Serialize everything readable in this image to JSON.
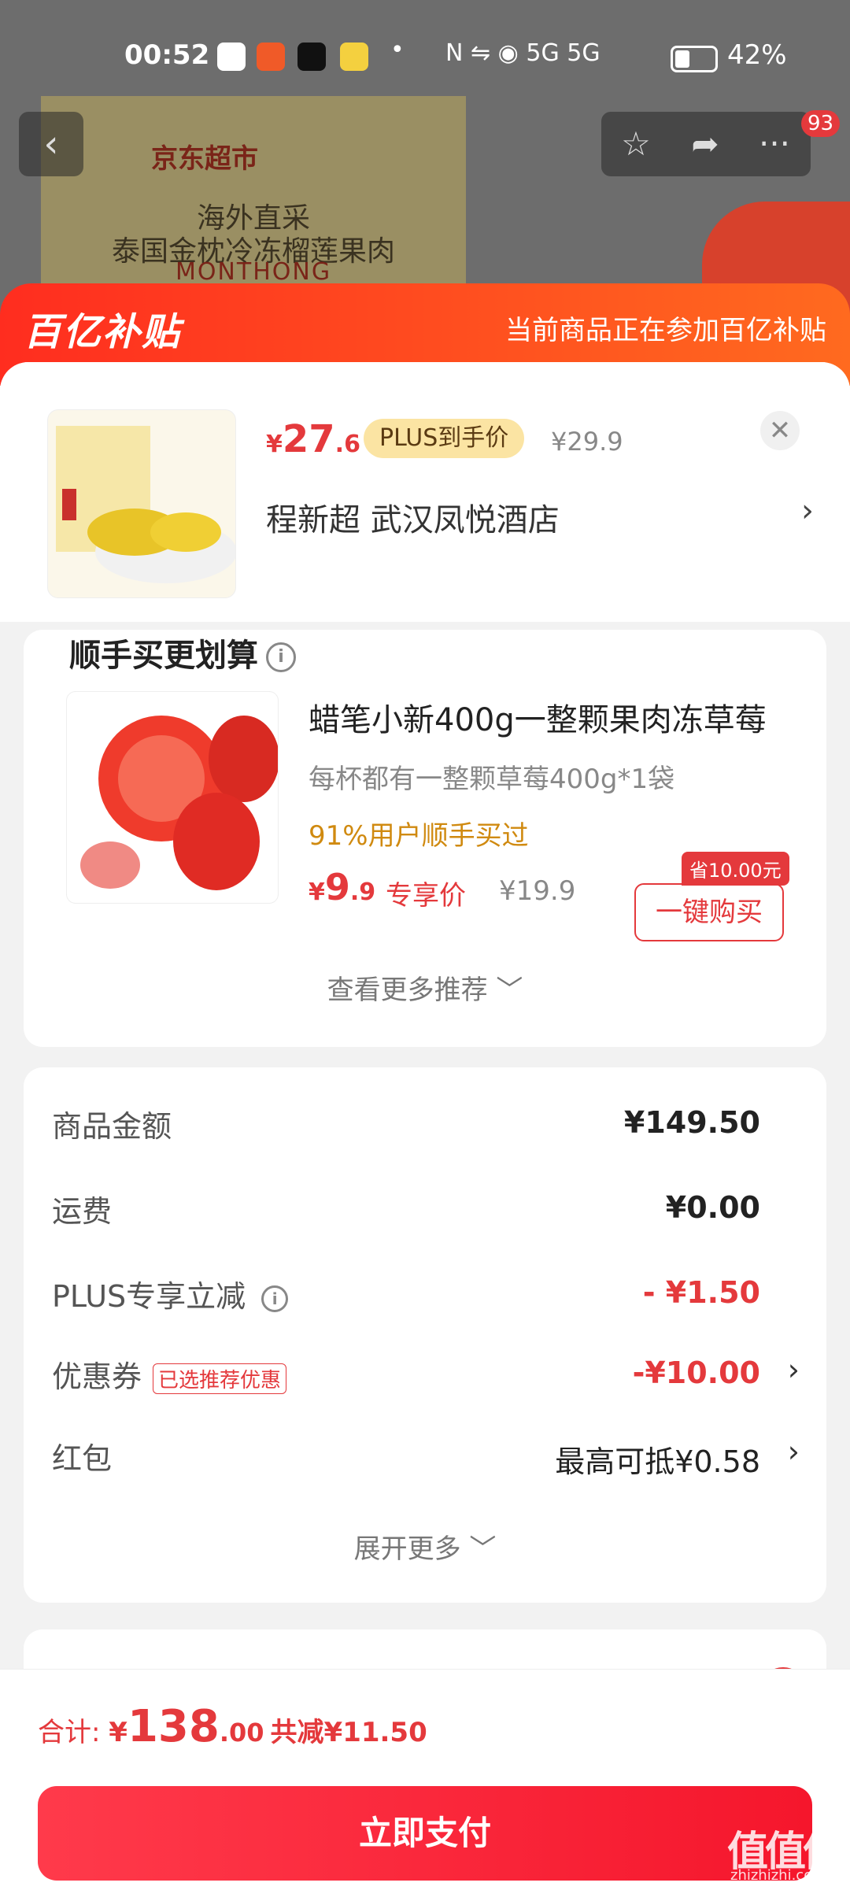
{
  "status": {
    "time": "00:52",
    "app_icons": [
      "baidu-icon",
      "manhua-icon",
      "tiktok-icon",
      "realme-icon"
    ],
    "right": "N ⇋ ◉ 5G 5G",
    "battery": "42%"
  },
  "background": {
    "store_logo": "京东超市",
    "line1": "海外直采",
    "line2": "泰国金枕冷冻榴莲果肉",
    "line3": "MONTHONG",
    "cart_badge": "93"
  },
  "banner": {
    "logo": "百亿补贴",
    "text": "当前商品正在参加百亿补贴"
  },
  "product": {
    "price_currency": "¥",
    "price_int": "27",
    "price_dec": ".6",
    "plus_tag": "PLUS到手价",
    "orig_price": "¥29.9",
    "address": "程新超  武汉凤悦酒店"
  },
  "combo": {
    "title": "顺手买更划算",
    "name": "蜡笔小新400g一整颗果肉冻草莓",
    "desc": "每杯都有一整颗草莓400g*1袋",
    "stat": "91%用户顺手买过",
    "price_currency": "¥",
    "price_int": "9",
    "price_dec": ".9",
    "tag": "专享价",
    "orig_price": "¥19.9",
    "save_badge": "省10.00元",
    "buy_label": "一键购买",
    "more_label": "查看更多推荐 ﹀"
  },
  "totals": {
    "rows": [
      {
        "label": "商品金额",
        "value": "¥149.50"
      },
      {
        "label": "运费",
        "value": "¥0.00"
      },
      {
        "label": "PLUS专享立减",
        "value": "- ¥1.50"
      },
      {
        "label": "优惠券",
        "tag": "已选推荐优惠",
        "value": "-¥10.00"
      },
      {
        "label": "红包",
        "value": "最高可抵¥0.58"
      }
    ],
    "expand_label": "展开更多 ﹀"
  },
  "footer": {
    "total_label": "合计: ",
    "currency": "¥",
    "total_int": "138",
    "total_dec": ".00",
    "saved": "共减¥11.50",
    "pay_label": "立即支付"
  },
  "watermark": {
    "main": "值值值",
    "sub": "zhizhizhi.com"
  },
  "colors": {
    "accent": "#e4393c",
    "banner": "#ff4a1f",
    "plus_tag": "#fbe4a3"
  }
}
